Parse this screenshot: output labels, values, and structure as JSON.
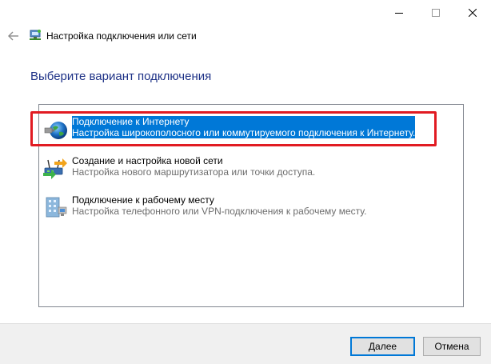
{
  "window": {
    "title": "Настройка подключения или сети",
    "controls": [
      "minimize",
      "maximize",
      "close"
    ]
  },
  "heading": "Выберите вариант подключения",
  "options": [
    {
      "title": "Подключение к Интернету",
      "description": "Настройка широкополосного или коммутируемого подключения к Интернету.",
      "icon": "globe-internet-icon",
      "selected": true
    },
    {
      "title": "Создание и настройка новой сети",
      "description": "Настройка нового маршрутизатора или точки доступа.",
      "icon": "router-network-icon",
      "selected": false
    },
    {
      "title": "Подключение к рабочему месту",
      "description": "Настройка телефонного или VPN-подключения к рабочему месту.",
      "icon": "workplace-building-icon",
      "selected": false
    }
  ],
  "buttons": {
    "next": "Далее",
    "cancel": "Отмена"
  },
  "colors": {
    "heading": "#1e3287",
    "selection": "#0078d7",
    "annotation": "#e11b22"
  }
}
